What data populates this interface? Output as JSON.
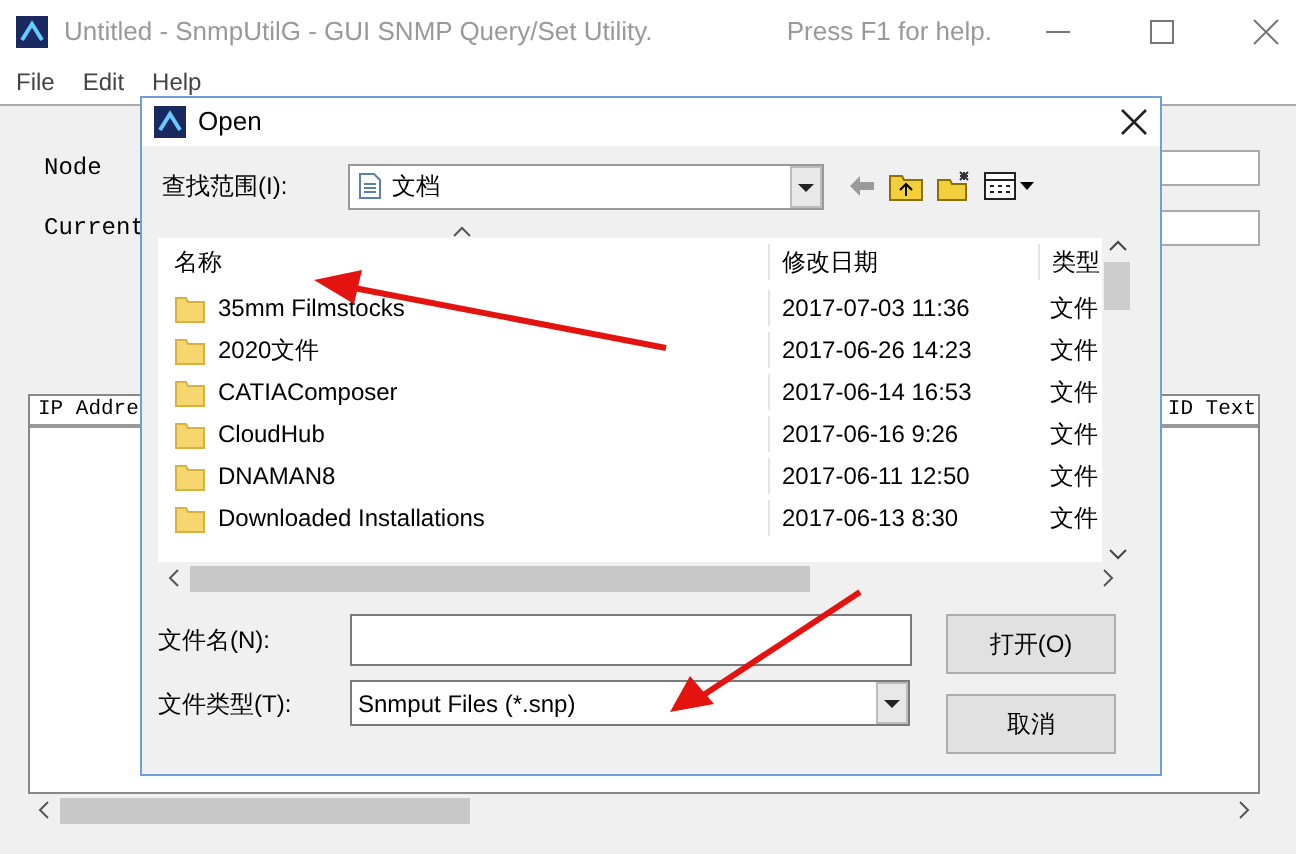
{
  "main_window": {
    "title": "Untitled - SnmpUtilG - GUI SNMP Query/Set Utility.",
    "help_hint": "Press F1 for help.",
    "menu": [
      "File",
      "Edit",
      "Help"
    ],
    "fields": [
      {
        "label": "Node"
      },
      {
        "label": "Current"
      }
    ],
    "list_columns": [
      "IP Addre",
      "ID Text"
    ]
  },
  "dialog": {
    "title": "Open",
    "look_in_label": "查找范围(I):",
    "look_in_value": "文档",
    "columns": [
      "名称",
      "修改日期",
      "类型"
    ],
    "files": [
      {
        "name": "35mm Filmstocks",
        "modified": "2017-07-03 11:36",
        "type": "文件"
      },
      {
        "name": "2020文件",
        "modified": "2017-06-26 14:23",
        "type": "文件"
      },
      {
        "name": "CATIAComposer",
        "modified": "2017-06-14 16:53",
        "type": "文件"
      },
      {
        "name": "CloudHub",
        "modified": "2017-06-16 9:26",
        "type": "文件"
      },
      {
        "name": "DNAMAN8",
        "modified": "2017-06-11 12:50",
        "type": "文件"
      },
      {
        "name": "Downloaded Installations",
        "modified": "2017-06-13 8:30",
        "type": "文件"
      }
    ],
    "filename_label": "文件名(N):",
    "filetype_label": "文件类型(T):",
    "filetype_value": "Snmput Files (*.snp)",
    "buttons": [
      "打开(O)",
      "取消"
    ]
  }
}
